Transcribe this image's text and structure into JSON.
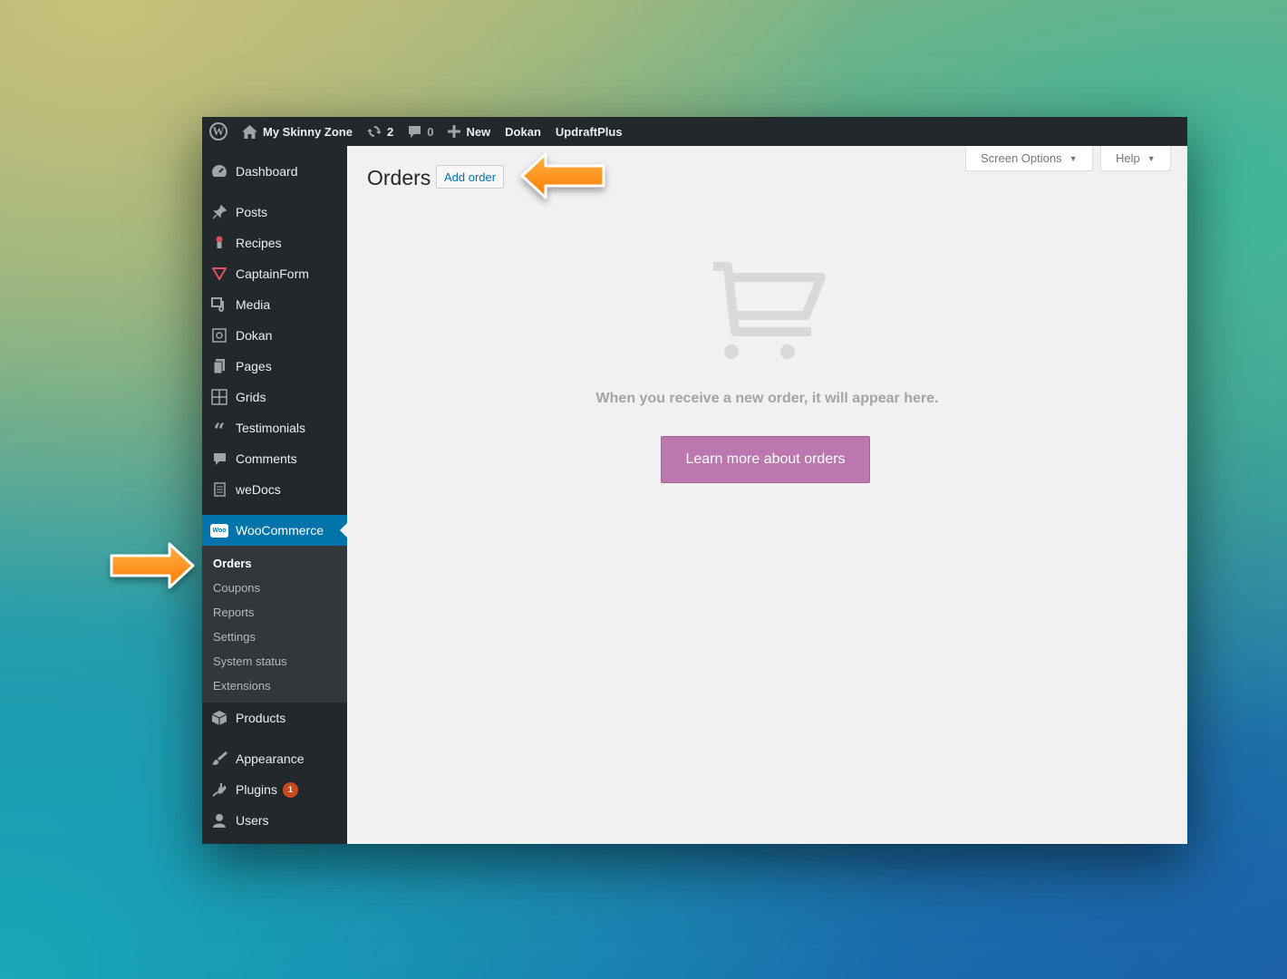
{
  "adminbar": {
    "site_name": "My Skinny Zone",
    "updates_count": "2",
    "comments_count": "0",
    "new_label": "New",
    "dokan_label": "Dokan",
    "updraft_label": "UpdraftPlus"
  },
  "sidebar": {
    "dashboard": "Dashboard",
    "posts": "Posts",
    "recipes": "Recipes",
    "captainform": "CaptainForm",
    "media": "Media",
    "dokan": "Dokan",
    "pages": "Pages",
    "grids": "Grids",
    "testimonials": "Testimonials",
    "comments": "Comments",
    "wedocs": "weDocs",
    "woocommerce": "WooCommerce",
    "woo_icon_text": "Woo",
    "submenu": {
      "orders": "Orders",
      "coupons": "Coupons",
      "reports": "Reports",
      "settings": "Settings",
      "system_status": "System status",
      "extensions": "Extensions"
    },
    "products": "Products",
    "appearance": "Appearance",
    "plugins": "Plugins",
    "plugins_badge": "1",
    "users": "Users"
  },
  "content": {
    "page_title": "Orders",
    "add_order": "Add order",
    "screen_options": "Screen Options",
    "help": "Help",
    "empty_message": "When you receive a new order, it will appear here.",
    "learn_more": "Learn more about orders"
  },
  "colors": {
    "admin_bar": "#23282d",
    "active_menu": "#0073aa",
    "woo_purple": "#bb77ae",
    "arrow_orange": "#ff8c00"
  }
}
